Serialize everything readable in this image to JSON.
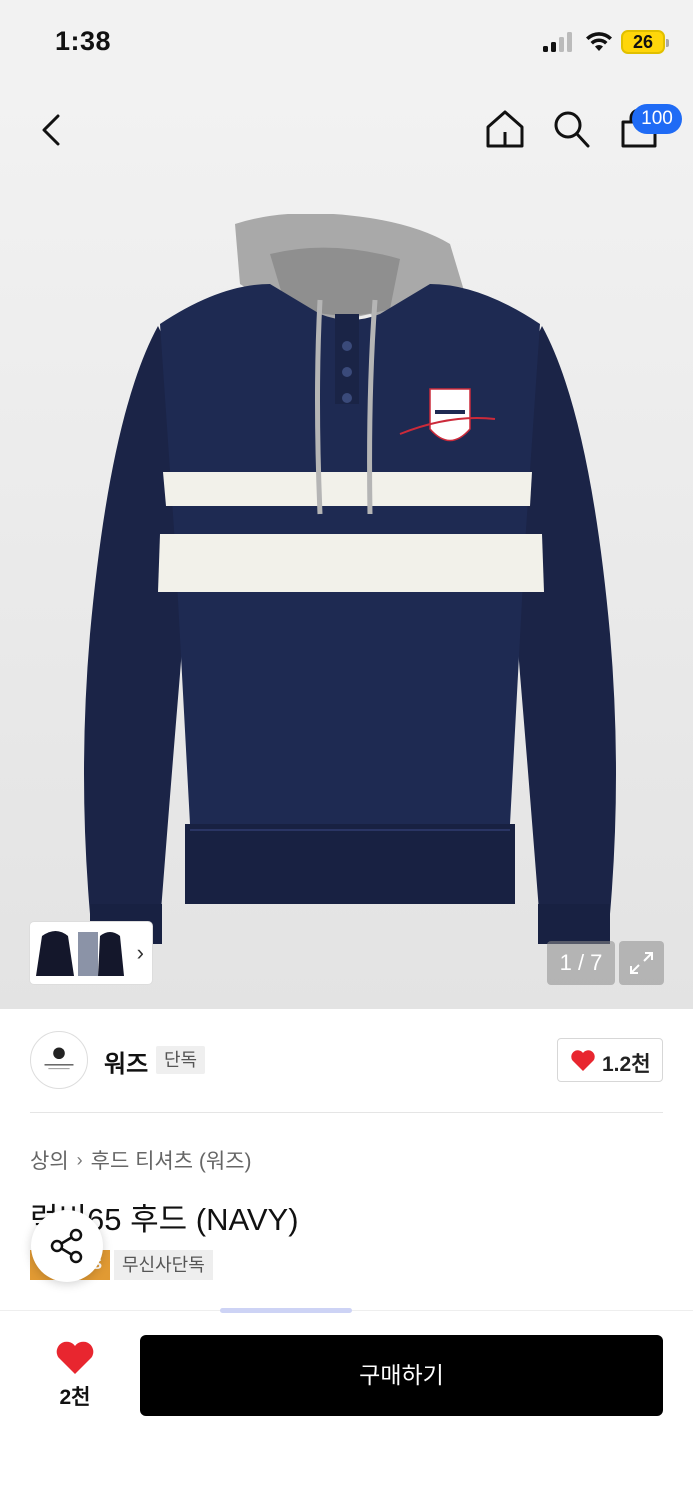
{
  "status_bar": {
    "time": "1:38",
    "battery": "26"
  },
  "nav": {
    "cart_badge": "100"
  },
  "gallery": {
    "current_page": "1 / 7"
  },
  "brand": {
    "name": "워즈",
    "tag": "단독",
    "likes": "1.2천"
  },
  "breadcrumb": {
    "category": "상의",
    "subcategory": "후드 티셔츠 (워즈)"
  },
  "product": {
    "title": "럭비65 후드 (NAVY)",
    "badge_exclusive": "무신사단독",
    "badge_orange_text": "S"
  },
  "bottom": {
    "wish_count": "2천",
    "buy_label": "구매하기"
  },
  "colors": {
    "accent_blue": "#1f6bf5",
    "heart_red": "#e8262f",
    "navy": "#1b2447"
  }
}
